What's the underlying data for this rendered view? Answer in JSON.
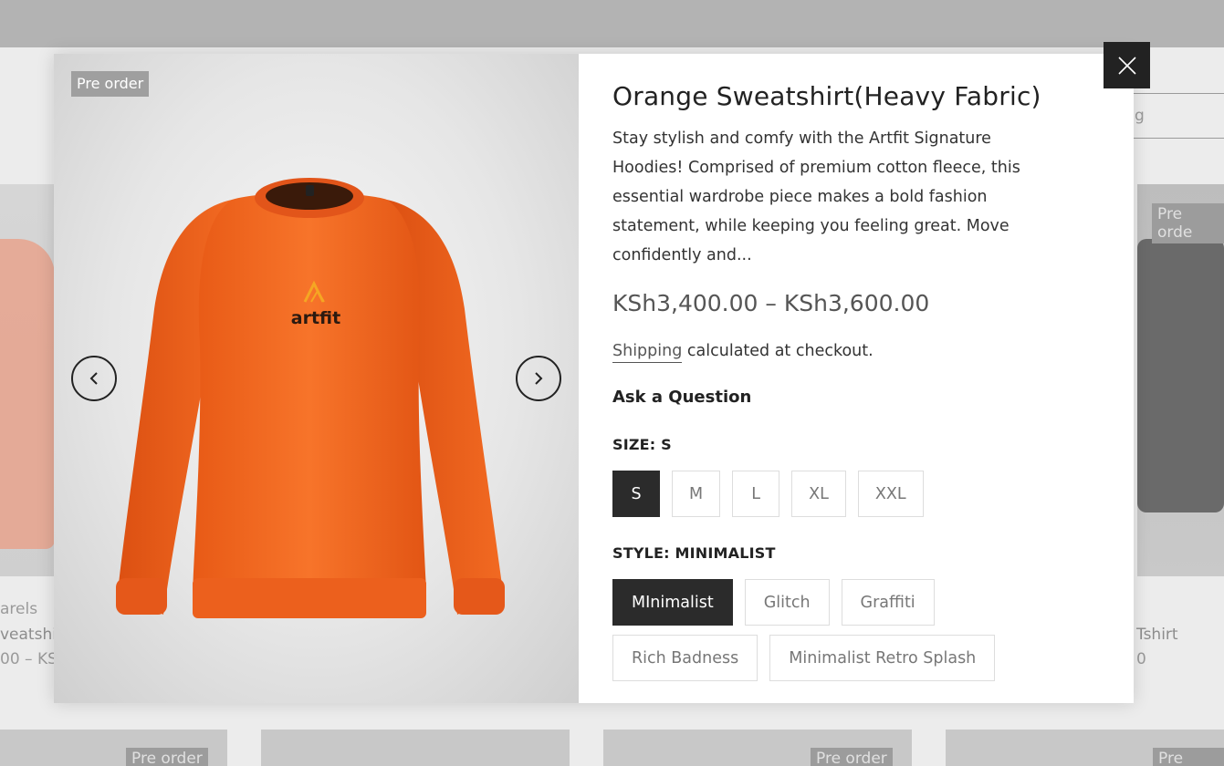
{
  "background": {
    "search_placeholder": "g",
    "left_card": {
      "vendor": "arels",
      "title": "veatshi",
      "price": "00 – KS"
    },
    "right_card": {
      "badge": "Pre orde",
      "title": "Tshirt",
      "price": "0"
    },
    "bottom_badges": [
      "Pre order",
      "Pre order",
      "Pre orde"
    ]
  },
  "modal": {
    "badge": "Pre order",
    "title": "Orange Sweatshirt(Heavy Fabric)",
    "description": "Stay stylish and comfy with the Artfit Signature Hoodies! Comprised of premium cotton fleece, this essential wardrobe piece makes a bold fashion statement, while keeping you feeling great. Move confidently and...",
    "price": "KSh3,400.00 – KSh3,600.00",
    "shipping_link": "Shipping",
    "shipping_rest": " calculated at checkout.",
    "ask_question": "Ask a Question",
    "size_label": "SIZE: S",
    "sizes": [
      "S",
      "M",
      "L",
      "XL",
      "XXL"
    ],
    "selected_size": "S",
    "style_label": "STYLE: MINIMALIST",
    "styles": [
      "MInimalist",
      "Glitch",
      "Graffiti",
      "Rich Badness",
      "Minimalist Retro Splash"
    ],
    "selected_style": "MInimalist",
    "logo_text": "artfit"
  },
  "colors": {
    "sweatshirt": "#f26a22",
    "dark": "#2b2b2b"
  }
}
